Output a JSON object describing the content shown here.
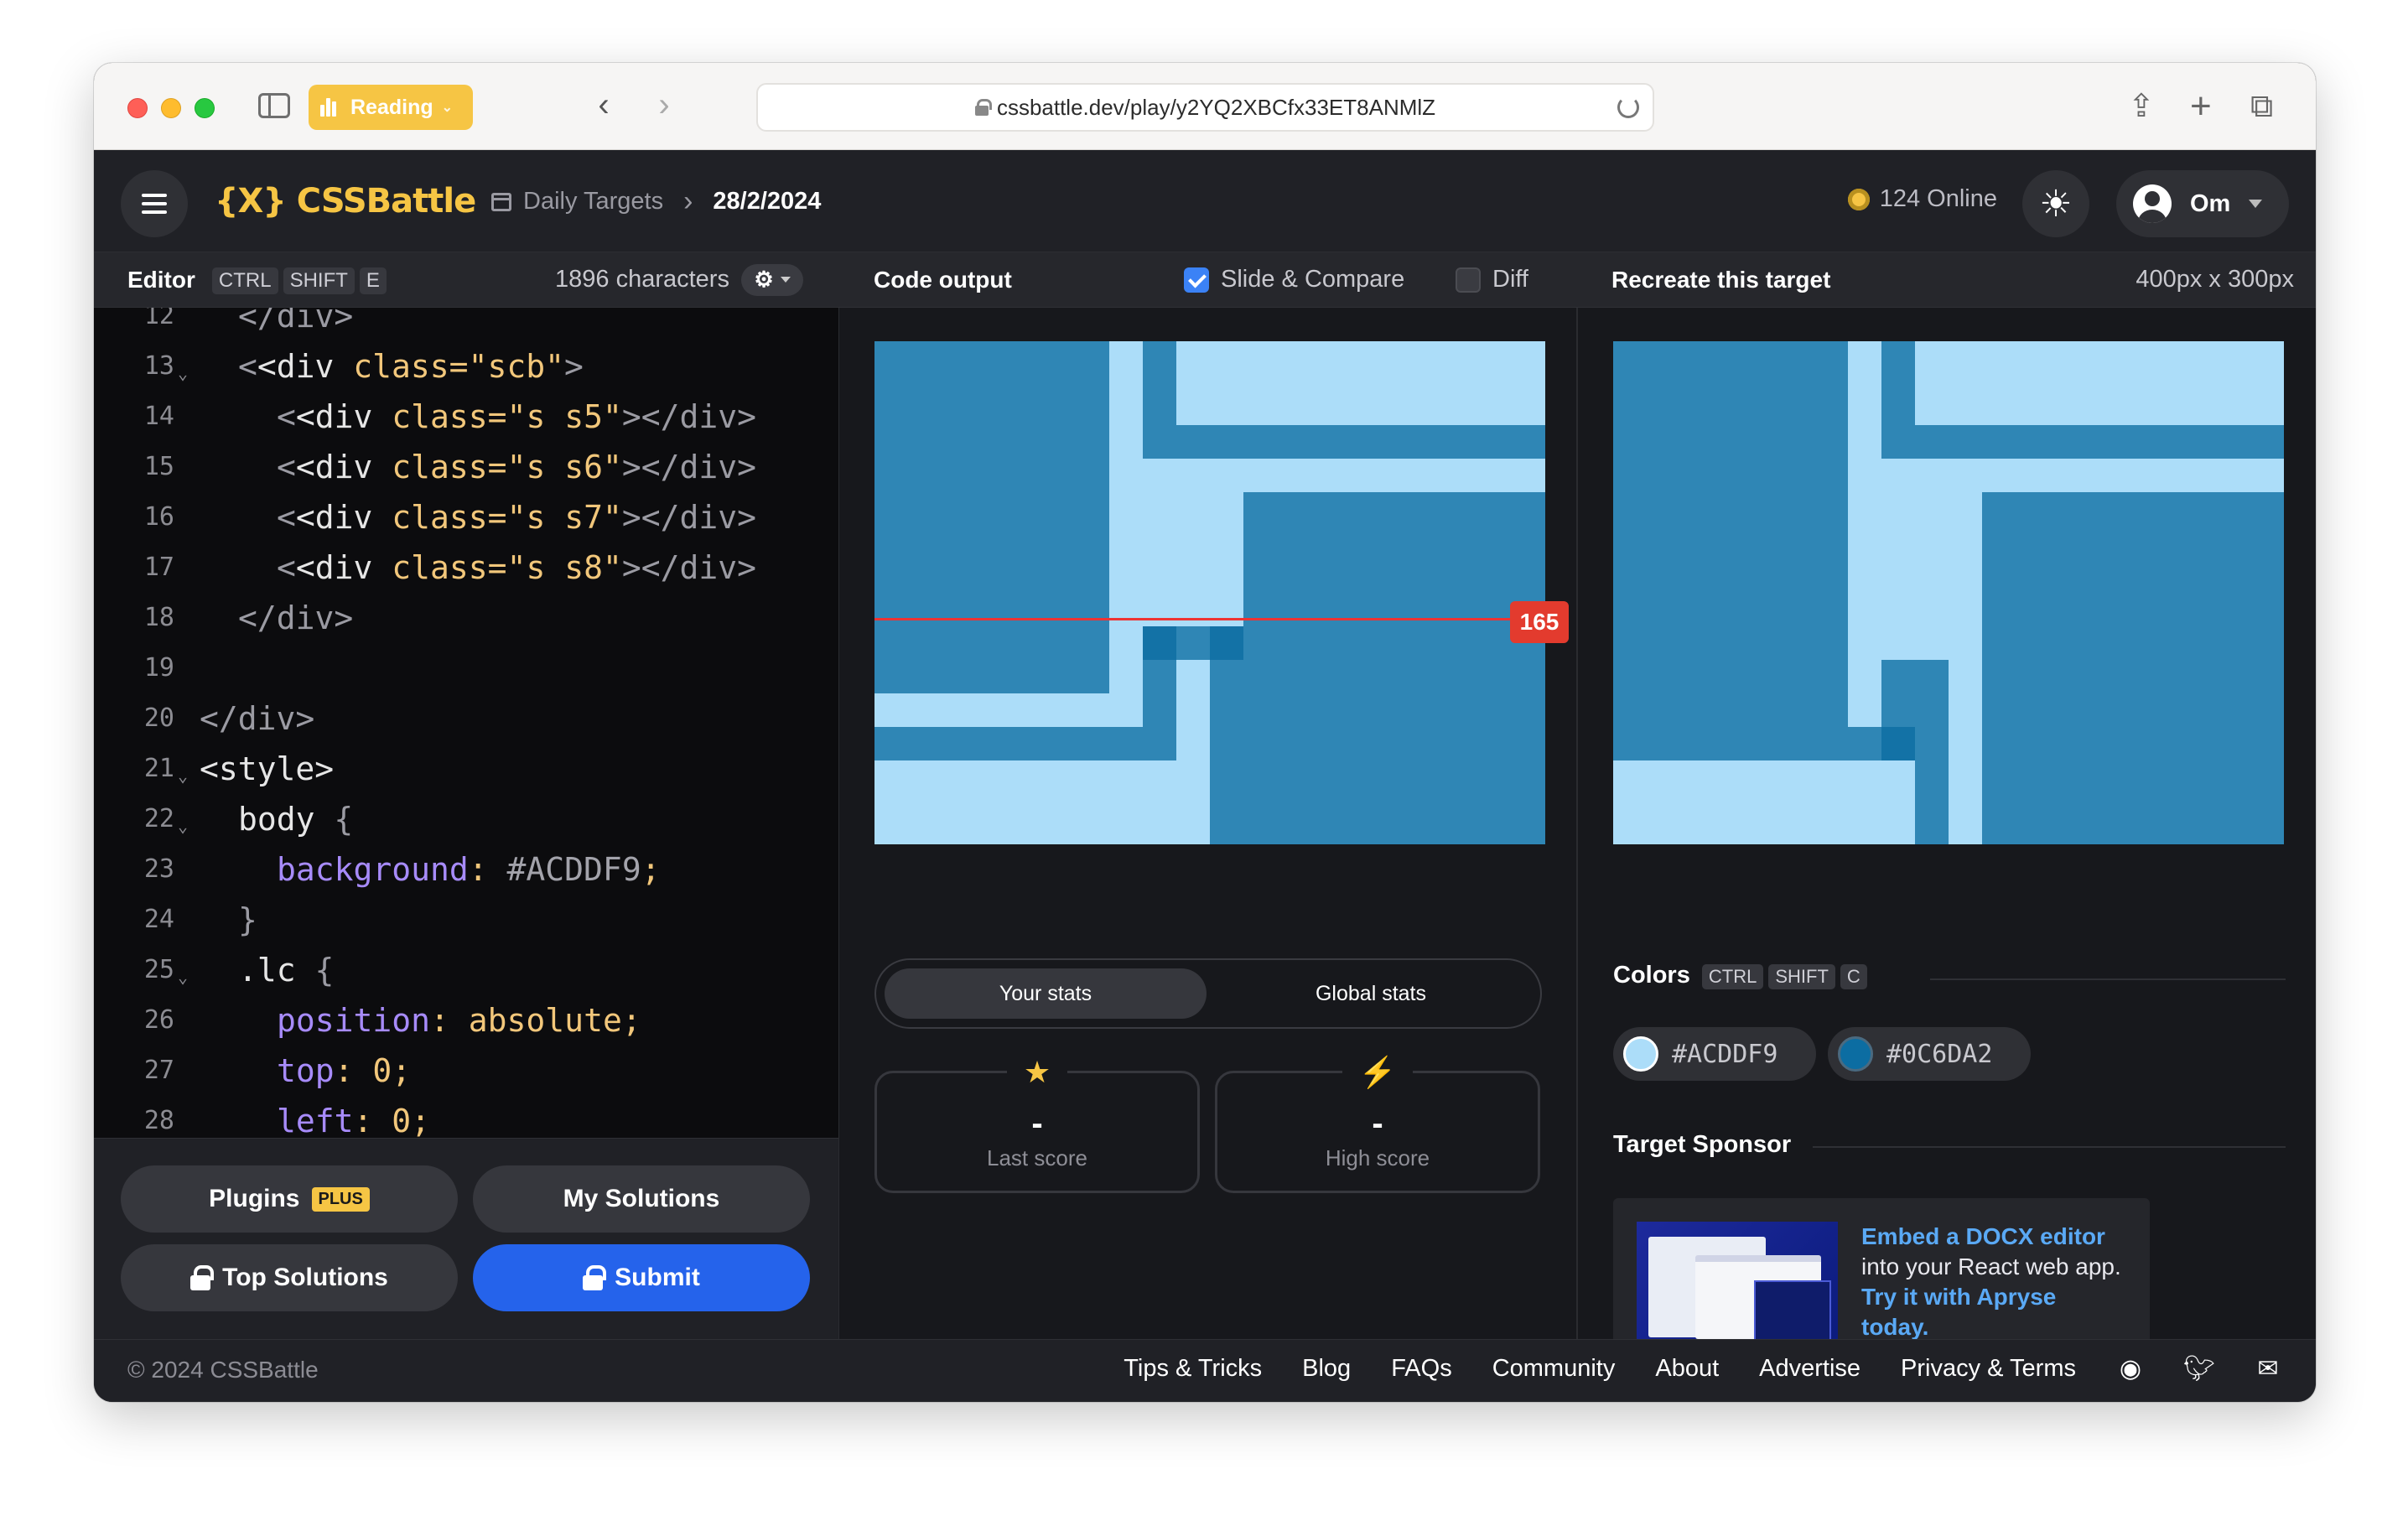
{
  "browser": {
    "reading_label": "Reading",
    "url": "cssbattle.dev/play/y2YQ2XBCfx33ET8ANMlZ"
  },
  "header": {
    "logo": "{X} CSSBattle",
    "breadcrumb_section": "Daily Targets",
    "breadcrumb_date": "28/2/2024",
    "online": "124 Online",
    "user_name": "Om"
  },
  "editor": {
    "title": "Editor",
    "shortcut": [
      "CTRL",
      "SHIFT",
      "E"
    ],
    "char_count": "1896 characters",
    "lines": [
      {
        "n": "12",
        "fold": false
      },
      {
        "n": "13",
        "fold": true
      },
      {
        "n": "14",
        "fold": false
      },
      {
        "n": "15",
        "fold": false
      },
      {
        "n": "16",
        "fold": false
      },
      {
        "n": "17",
        "fold": false
      },
      {
        "n": "18",
        "fold": false
      },
      {
        "n": "19",
        "fold": false
      },
      {
        "n": "20",
        "fold": false
      },
      {
        "n": "21",
        "fold": true
      },
      {
        "n": "22",
        "fold": true
      },
      {
        "n": "23",
        "fold": false
      },
      {
        "n": "24",
        "fold": false
      },
      {
        "n": "25",
        "fold": true
      },
      {
        "n": "26",
        "fold": false
      },
      {
        "n": "27",
        "fold": false
      },
      {
        "n": "28",
        "fold": false
      }
    ],
    "code": {
      "l12": "</div>",
      "l13a": "<div ",
      "l13b": "class=",
      "l13c": "\"scb\"",
      "l13d": ">",
      "l14a": "<div ",
      "l14b": "class=",
      "l14c": "\"s s5\"",
      "l14d": "></div>",
      "l15a": "<div ",
      "l15b": "class=",
      "l15c": "\"s s6\"",
      "l15d": "></div>",
      "l16a": "<div ",
      "l16b": "class=",
      "l16c": "\"s s7\"",
      "l16d": "></div>",
      "l17a": "<div ",
      "l17b": "class=",
      "l17c": "\"s s8\"",
      "l17d": "></div>",
      "l18": "</div>",
      "l20": "</div>",
      "l21": "<style>",
      "l22a": "body ",
      "l22b": "{",
      "l23a": "background",
      "l23b": ": ",
      "l23c": "#ACDDF9",
      "l23d": ";",
      "l24": "}",
      "l25a": ".lc ",
      "l25b": "{",
      "l26a": "position",
      "l26b": ": ",
      "l26c": "absolute",
      "l26d": ";",
      "l27a": "top",
      "l27b": ": ",
      "l27c": "0",
      "l27d": ";",
      "l28a": "left",
      "l28b": ": ",
      "l28c": "0",
      "l28d": ";"
    },
    "buttons": {
      "plugins": "Plugins",
      "plus_badge": "PLUS",
      "my_solutions": "My Solutions",
      "top_solutions": "Top Solutions",
      "submit": "Submit"
    }
  },
  "output": {
    "title": "Code output",
    "slide_compare": "Slide & Compare",
    "slide_compare_checked": true,
    "diff": "Diff",
    "diff_checked": false,
    "slider_value": "165",
    "tabs": [
      "Your stats",
      "Global stats"
    ],
    "last_score_value": "-",
    "last_score_label": "Last score",
    "high_score_value": "-",
    "high_score_label": "High score"
  },
  "target": {
    "title": "Recreate this target",
    "size": "400px x 300px",
    "colors_title": "Colors",
    "colors_shortcut": [
      "CTRL",
      "SHIFT",
      "C"
    ],
    "colors": [
      "#ACDDF9",
      "#0C6DA2"
    ],
    "sponsor_title": "Target Sponsor",
    "ad_line1": "Embed a DOCX editor",
    "ad_line2": "into your React web app.",
    "ad_line3": "Try it with Apryse today."
  },
  "footer": {
    "copyright": "© 2024 CSSBattle",
    "links": [
      "Tips & Tricks",
      "Blog",
      "FAQs",
      "Community",
      "About",
      "Advertise",
      "Privacy & Terms"
    ]
  },
  "colors": {
    "accent": "#f6c544",
    "submit_blue": "#2563eb",
    "light": "#acddf9",
    "dark": "#0c6da2"
  }
}
